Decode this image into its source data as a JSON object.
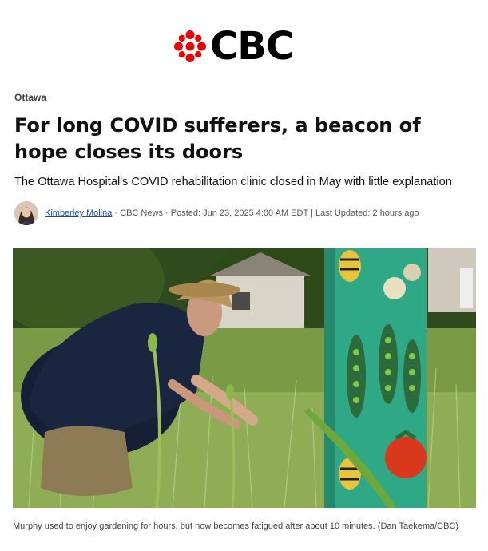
{
  "logo": {
    "text": "CBC",
    "brand_color": "#e60505"
  },
  "section": "Ottawa",
  "headline": "For long COVID sufferers, a beacon of hope closes its doors",
  "subhead": "The Ottawa Hospital's COVID rehabilitation clinic closed in May with little explanation",
  "byline": {
    "author": "Kimberley Molina",
    "outlet": "CBC News",
    "posted": "Posted: Jun 23, 2025 4:00 AM EDT",
    "updated": "Last Updated: 2 hours ago",
    "sep_dot": " · ",
    "sep_bar": " | "
  },
  "photo": {
    "icon": "garden-photo"
  },
  "caption": "Murphy used to enjoy gardening for hours, but now becomes fatigued after about 10 minutes. (Dan Taekema/CBC)"
}
